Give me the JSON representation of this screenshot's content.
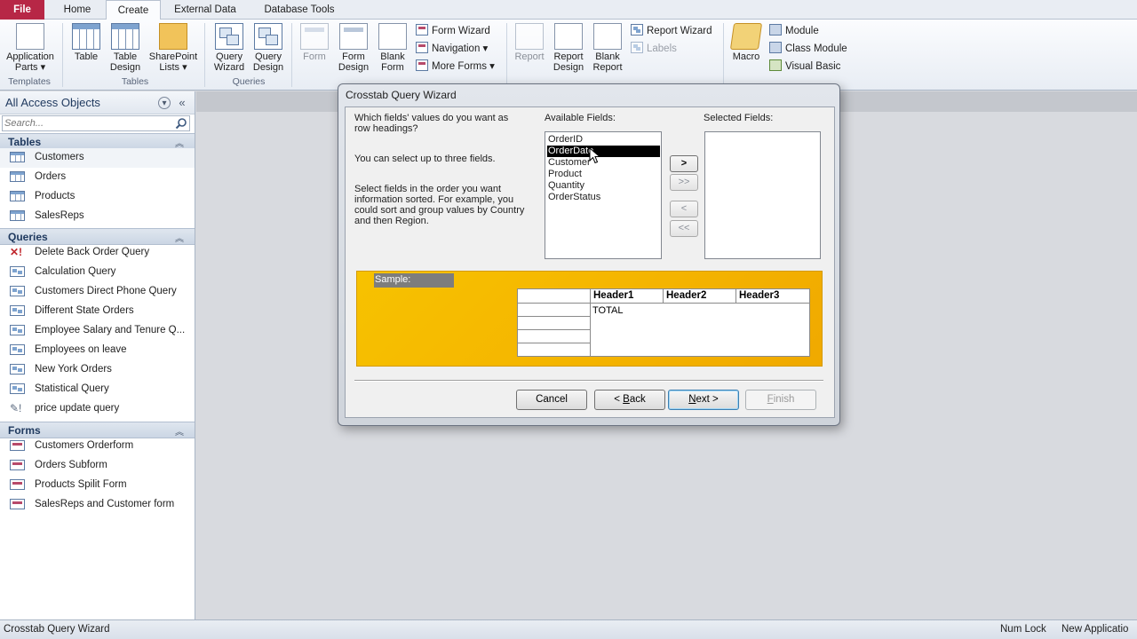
{
  "tabs": [
    "File",
    "Home",
    "Create",
    "External Data",
    "Database Tools"
  ],
  "ribbon": {
    "templates": {
      "group": "Templates",
      "app_parts": "Application Parts ▾"
    },
    "tables": {
      "group": "Tables",
      "table": "Table",
      "table_design": "Table Design",
      "sharepoint": "SharePoint Lists ▾"
    },
    "queries": {
      "group": "Queries",
      "wizard": "Query Wizard",
      "design": "Query Design"
    },
    "forms": {
      "form": "Form",
      "form_design": "Form Design",
      "blank_form": "Blank Form",
      "form_wizard": "Form Wizard",
      "navigation": "Navigation ▾",
      "more_forms": "More Forms ▾"
    },
    "reports": {
      "report": "Report",
      "report_design": "Report Design",
      "blank_report": "Blank Report",
      "report_wizard": "Report Wizard",
      "labels": "Labels"
    },
    "macros": {
      "macro": "Macro",
      "module": "Module",
      "class_module": "Class Module",
      "visual_basic": "Visual Basic"
    }
  },
  "nav": {
    "title": "All Access Objects",
    "search_placeholder": "Search...",
    "tables": {
      "label": "Tables",
      "items": [
        "Customers",
        "Orders",
        "Products",
        "SalesReps"
      ]
    },
    "queries": {
      "label": "Queries",
      "items": [
        "Delete Back Order Query",
        "Calculation Query",
        "Customers Direct Phone Query",
        "Different State Orders",
        "Employee Salary and Tenure Q...",
        "Employees on leave",
        "New York Orders",
        "Statistical Query",
        "price update query"
      ]
    },
    "forms": {
      "label": "Forms",
      "items": [
        "Customers Orderform",
        "Orders Subform",
        "Products Spilit Form",
        "SalesReps and Customer form"
      ]
    }
  },
  "dialog": {
    "title": "Crosstab Query Wizard",
    "instr1": "Which fields' values do you want as row headings?",
    "instr2": "You can select up to three fields.",
    "instr3": "Select fields in the order you want information sorted.  For example, you could sort and group values by Country and then Region.",
    "available_label": "Available Fields:",
    "selected_label": "Selected Fields:",
    "available_fields": [
      "OrderID",
      "OrderDate",
      "Customer",
      "Product",
      "Quantity",
      "OrderStatus"
    ],
    "selected_index": 1,
    "move_buttons": [
      ">",
      ">>",
      "<",
      "<<"
    ],
    "sample_label": "Sample:",
    "sample_headers": [
      "Header1",
      "Header2",
      "Header3"
    ],
    "sample_total": "TOTAL",
    "buttons": {
      "cancel": "Cancel",
      "back_prefix": "< ",
      "back_key": "B",
      "back_rest": "ack",
      "next_key": "N",
      "next_rest": "ext >",
      "finish_key": "F",
      "finish_rest": "inish"
    }
  },
  "status": {
    "left": "Crosstab Query Wizard",
    "numlock": "Num Lock",
    "right": "New Applicatio"
  },
  "colors": {
    "file_tab": "#b72746",
    "sample_bg": "#f5b700",
    "selection": "#000000"
  }
}
